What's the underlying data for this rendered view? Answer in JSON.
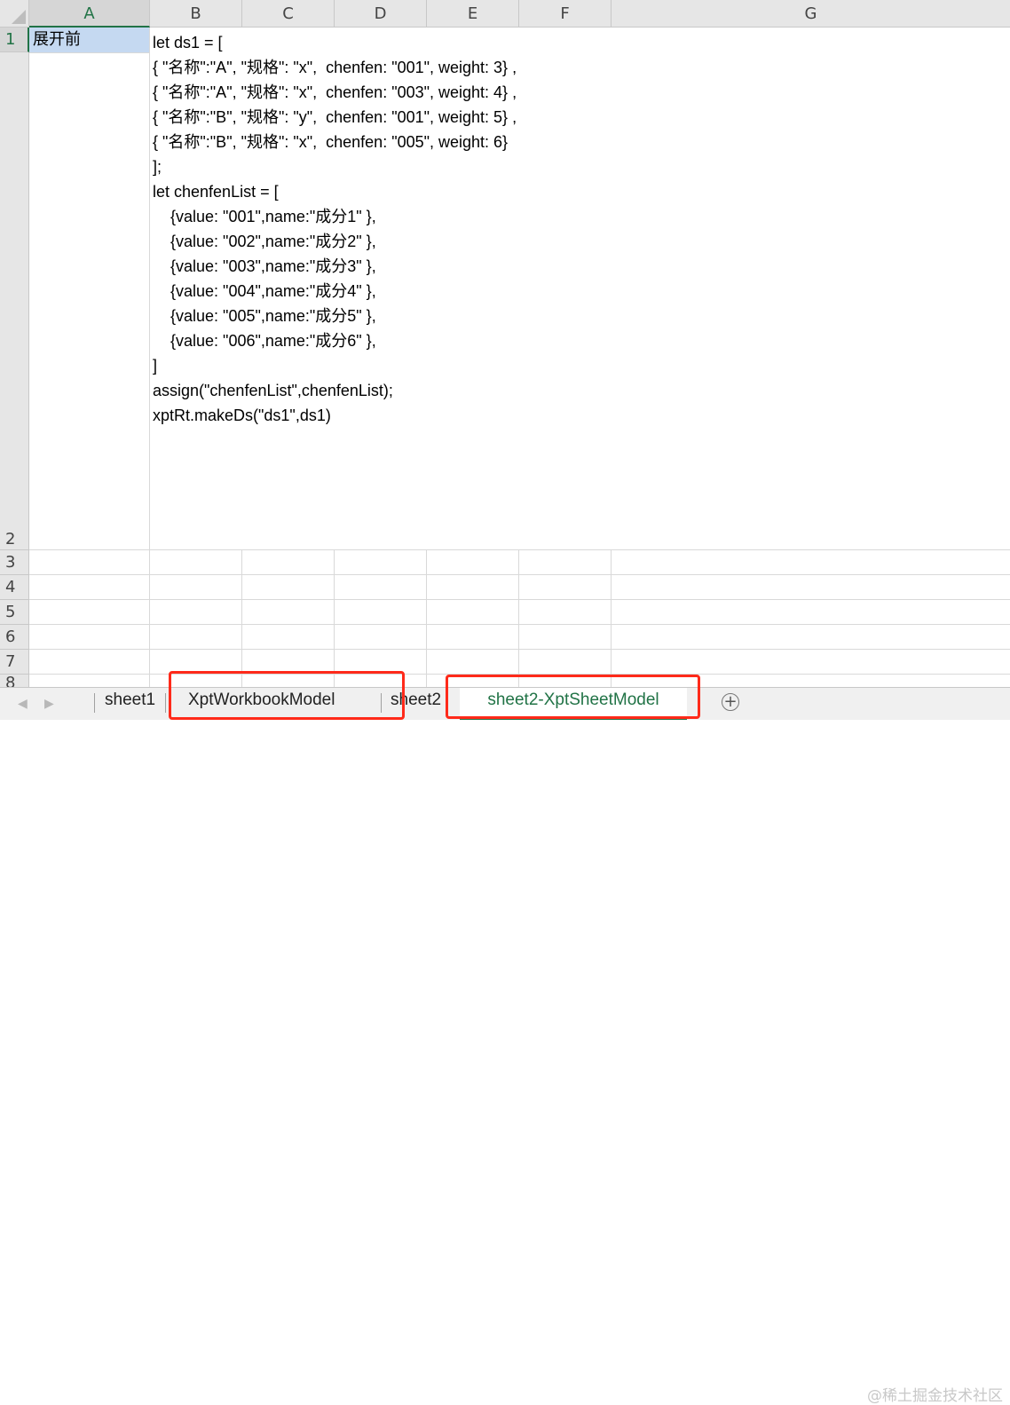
{
  "columns": [
    "A",
    "B",
    "C",
    "D",
    "E",
    "F",
    "G"
  ],
  "rows": [
    "1",
    "2",
    "3",
    "4",
    "5",
    "6",
    "7",
    "8"
  ],
  "cell_A1": "展开前",
  "code_lines": [
    "let ds1 = [",
    "{ \"名称\":\"A\", \"规格\": \"x\",  chenfen: \"001\", weight: 3} ,",
    "{ \"名称\":\"A\", \"规格\": \"x\",  chenfen: \"003\", weight: 4} ,",
    "{ \"名称\":\"B\", \"规格\": \"y\",  chenfen: \"001\", weight: 5} ,",
    "{ \"名称\":\"B\", \"规格\": \"x\",  chenfen: \"005\", weight: 6}",
    "];",
    "let chenfenList = [",
    "    {value: \"001\",name:\"成分1\" },",
    "    {value: \"002\",name:\"成分2\" },",
    "    {value: \"003\",name:\"成分3\" },",
    "    {value: \"004\",name:\"成分4\" },",
    "    {value: \"005\",name:\"成分5\" },",
    "    {value: \"006\",name:\"成分6\" },",
    "]",
    "assign(\"chenfenList\",chenfenList);",
    "xptRt.makeDs(\"ds1\",ds1)"
  ],
  "sheet_tabs": [
    {
      "label": "sheet1",
      "active": false
    },
    {
      "label": "XptWorkbookModel",
      "active": false
    },
    {
      "label": "sheet2",
      "active": false
    },
    {
      "label": "sheet2-XptSheetModel",
      "active": true
    }
  ],
  "nav": {
    "prev": "◀",
    "next": "▶"
  },
  "add_sheet_label": "+",
  "watermark": "@稀土掘金技术社区",
  "colors": {
    "accent": "#217346",
    "highlight_box": "#ff2a1a",
    "selected_cell": "#c5d9f1"
  }
}
